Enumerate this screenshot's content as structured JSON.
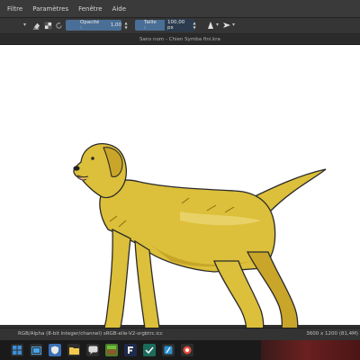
{
  "menu": {
    "items": [
      "Filtre",
      "Paramètres",
      "Fenêtre",
      "Aide"
    ]
  },
  "toolbar": {
    "opacity_label": "Opacité :",
    "opacity_value": "1,00",
    "size_label": "Taille :",
    "size_value": "100,00 px"
  },
  "document": {
    "title": "Sans nom - Chien Symba fini.kra"
  },
  "status": {
    "color_profile": "RGB/Alpha (8-bit integer/channel)  sRGB-elle-V2-srgbtrc.icc",
    "dimensions": "3600 x 1200 (81,4M)"
  },
  "colors": {
    "accent": "#4a6f96",
    "dog_body": "#dcbf3a",
    "dog_shadow": "#b8951c",
    "canvas": "#ffffff"
  }
}
